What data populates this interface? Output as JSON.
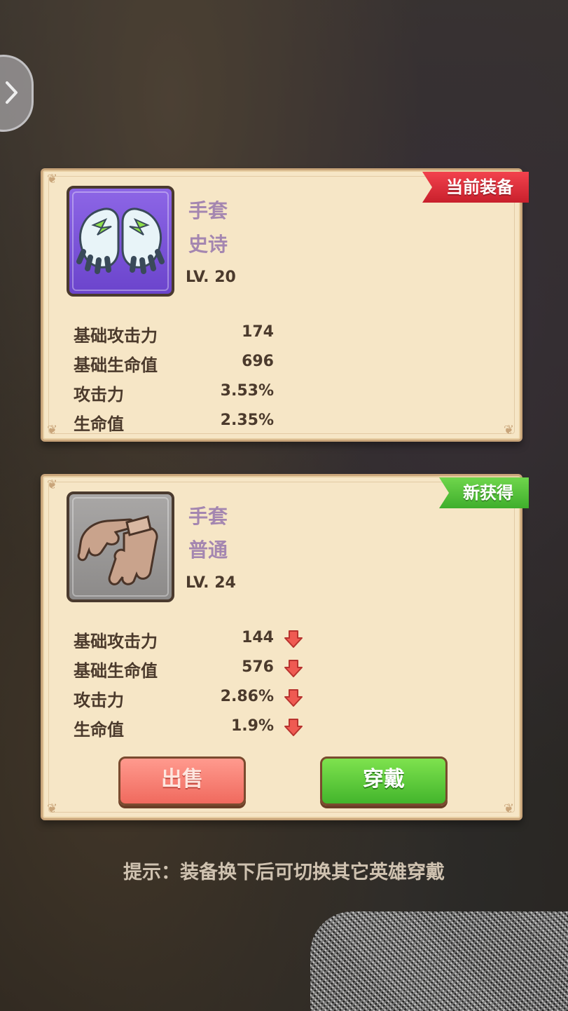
{
  "navigation": {
    "back_icon": "chevron-right-icon"
  },
  "current_item": {
    "badge": "当前装备",
    "badge_color": "#d8242e",
    "icon": "white-gloves-icon",
    "frame_color": "#7a55d9",
    "name": "手套",
    "rarity": "史诗",
    "level": "LV. 20",
    "stats": [
      {
        "label": "基础攻击力",
        "value": "174"
      },
      {
        "label": "基础生命值",
        "value": "696"
      },
      {
        "label": "攻击力",
        "value": "3.53%"
      },
      {
        "label": "生命值",
        "value": "2.35%"
      }
    ]
  },
  "new_item": {
    "badge": "新获得",
    "badge_color": "#52c236",
    "icon": "brown-gloves-icon",
    "frame_color": "#9a9897",
    "name": "手套",
    "rarity": "普通",
    "level": "LV. 24",
    "stats": [
      {
        "label": "基础攻击力",
        "value": "144",
        "trend": "down"
      },
      {
        "label": "基础生命值",
        "value": "576",
        "trend": "down"
      },
      {
        "label": "攻击力",
        "value": "2.86%",
        "trend": "down"
      },
      {
        "label": "生命值",
        "value": "1.9%",
        "trend": "down"
      }
    ],
    "sell_label": "出售",
    "wear_label": "穿戴"
  },
  "hint": "提示：装备换下后可切换其它英雄穿戴"
}
